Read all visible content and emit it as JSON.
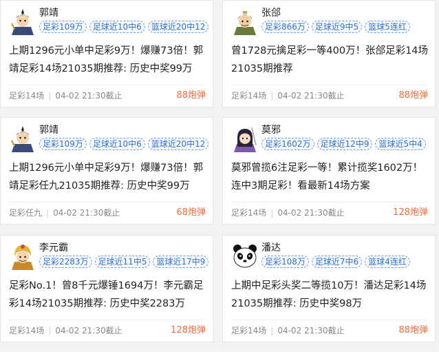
{
  "cards": [
    {
      "name": "郭靖",
      "avatar_icon": "warrior-avatar-icon",
      "tags": [
        "足彩109万",
        "足球近10中6",
        "篮球近20中12"
      ],
      "content": "上期1296元小单中足彩9万！爆赚73倍！郭靖足彩14场21035期推荐: 历史中奖99万",
      "category": "足彩14场",
      "deadline": "04-02 21:30截止",
      "price": "88炮弹"
    },
    {
      "name": "张郃",
      "avatar_icon": "general-avatar-icon",
      "tags": [
        "足彩866万",
        "足球近9中5",
        "篮球5连红"
      ],
      "content": "曾1728元擒足彩一等400万！张郃足彩14场21035期推荐",
      "category": "足彩14场",
      "deadline": "04-02 21:30截止",
      "price": "88炮弹"
    },
    {
      "name": "郭靖",
      "avatar_icon": "warrior-avatar-icon",
      "tags": [
        "足彩109万",
        "足球近10中6",
        "篮球近20中12"
      ],
      "content": "上期1296元小单中足彩9万！爆赚73倍！郭靖足彩任九21035期推荐: 历史中奖99万",
      "category": "足彩任九",
      "deadline": "04-02 21:30截止",
      "price": "68炮弹"
    },
    {
      "name": "莫邪",
      "avatar_icon": "swordswoman-avatar-icon",
      "tags": [
        "足彩1602万",
        "足球近12中9",
        "篮球近5中4"
      ],
      "content": "莫邪曾揽6注足彩一等！累计揽奖1602万！连中3期足彩！看最新14场方案",
      "category": "足彩14场",
      "deadline": "04-02 21:30截止",
      "price": "128炮弹"
    },
    {
      "name": "李元霸",
      "avatar_icon": "golden-helmet-avatar-icon",
      "tags": [
        "足彩2283万",
        "足球近11中5",
        "篮球近17中9"
      ],
      "content": "足彩No.1！曾8千元爆锤1694万！李元霸足彩14场21035期推荐: 历史中奖2283万",
      "category": "足彩14场",
      "deadline": "04-02 21:30截止",
      "price": "128炮弹"
    },
    {
      "name": "潘达",
      "avatar_icon": "panda-avatar-icon",
      "tags": [
        "足彩108万",
        "足球近7中6",
        "篮球4连红"
      ],
      "content": "上期中足彩头奖二等揽10万！潘达足彩14场21035期推荐: 历史中奖98万",
      "category": "足彩14场",
      "deadline": "04-02 21:30截止",
      "price": "88炮弹"
    }
  ]
}
